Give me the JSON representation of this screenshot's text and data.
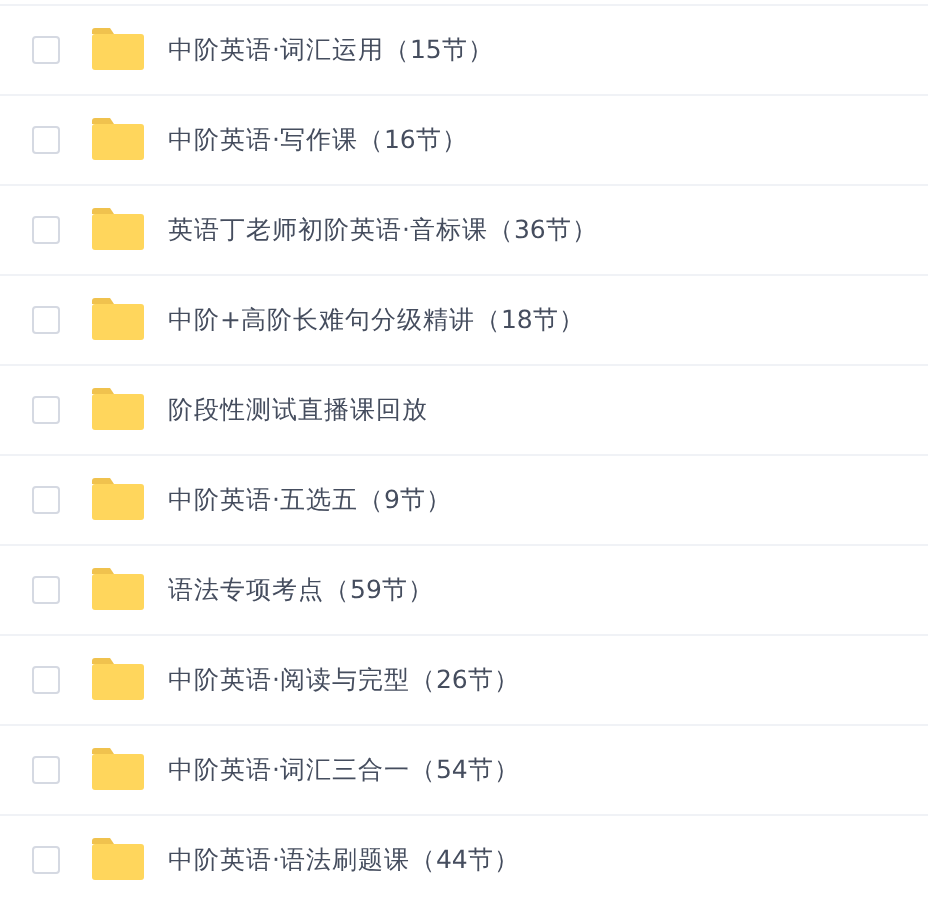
{
  "folders": [
    {
      "name": "中阶英语·词汇运用（15节）",
      "checked": false
    },
    {
      "name": "中阶英语·写作课（16节）",
      "checked": false
    },
    {
      "name": "英语丁老师初阶英语·音标课（36节）",
      "checked": false
    },
    {
      "name": "中阶+高阶长难句分级精讲（18节）",
      "checked": false
    },
    {
      "name": "阶段性测试直播课回放",
      "checked": false
    },
    {
      "name": "中阶英语·五选五（9节）",
      "checked": false
    },
    {
      "name": "语法专项考点（59节）",
      "checked": false
    },
    {
      "name": "中阶英语·阅读与完型（26节）",
      "checked": false
    },
    {
      "name": "中阶英语·词汇三合一（54节）",
      "checked": false
    },
    {
      "name": "中阶英语·语法刷题课（44节）",
      "checked": false
    }
  ]
}
